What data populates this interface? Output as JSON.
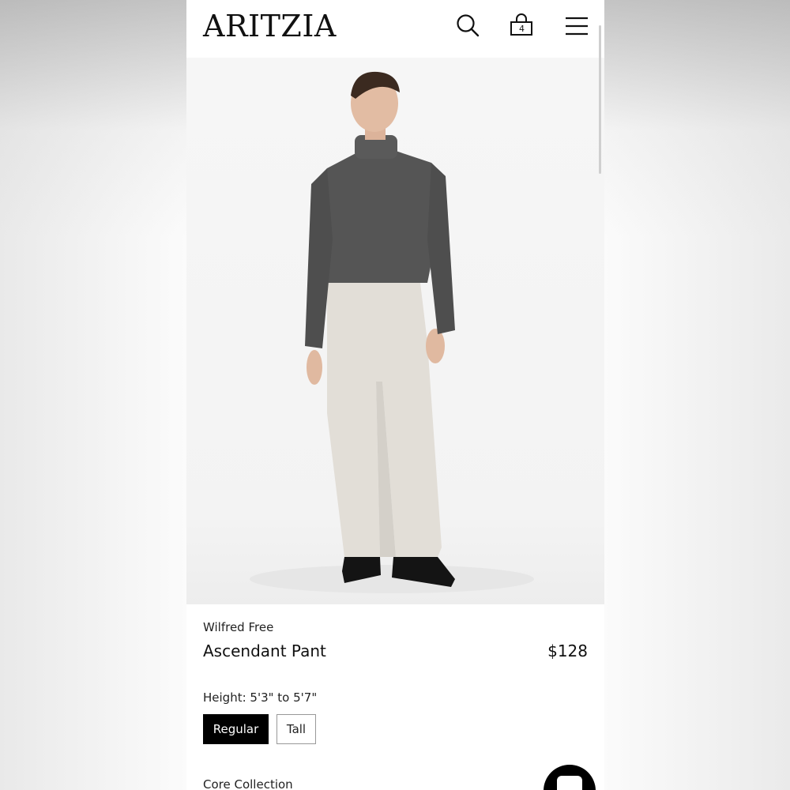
{
  "header": {
    "logo": "ARITZIA",
    "bag_count": "4"
  },
  "icons": {
    "search": "search-icon",
    "bag": "shopping-bag-icon",
    "menu": "hamburger-menu-icon",
    "chat": "chat-icon"
  },
  "product": {
    "brand": "Wilfred Free",
    "name": "Ascendant Pant",
    "price": "$128",
    "height_label": "Height: 5'3\" to 5'7\"",
    "sizes": [
      {
        "label": "Regular",
        "selected": true
      },
      {
        "label": "Tall",
        "selected": false
      }
    ],
    "collection": "Core Collection"
  },
  "colors": {
    "accent": "#000000",
    "sweater": "#555555",
    "pants": "#e4e1db"
  }
}
